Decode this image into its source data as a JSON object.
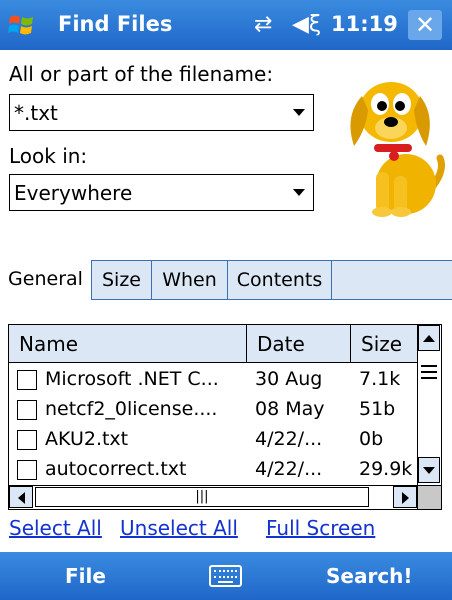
{
  "titlebar": {
    "title": "Find Files",
    "time": "11:19",
    "close_label": "✕",
    "icons": [
      "windows-start-icon",
      "connectivity-icon",
      "volume-icon"
    ]
  },
  "search": {
    "filename_label": "All or part of the filename:",
    "filename_value": "*.txt",
    "lookin_label": "Look in:",
    "lookin_value": "Everywhere"
  },
  "tabs": [
    {
      "label": "General",
      "active": true
    },
    {
      "label": "Size",
      "active": false
    },
    {
      "label": "When",
      "active": false
    },
    {
      "label": "Contents",
      "active": false
    }
  ],
  "results": {
    "columns": [
      "Name",
      "Date",
      "Size"
    ],
    "rows": [
      {
        "name": "Microsoft .NET C...",
        "date": "30 Aug",
        "size": "7.1k"
      },
      {
        "name": "netcf2_0license....",
        "date": "08 May",
        "size": "51b"
      },
      {
        "name": "AKU2.txt",
        "date": "4/22/...",
        "size": "0b"
      },
      {
        "name": "autocorrect.txt",
        "date": "4/22/...",
        "size": "29.9k"
      }
    ]
  },
  "links": {
    "select_all": "Select All",
    "unselect_all": "Unselect All",
    "full_screen": "Full Screen"
  },
  "menubar": {
    "left": "File",
    "right": "Search!",
    "center_icon": "keyboard-icon"
  },
  "colors": {
    "bar_blue": "#1f67c8",
    "tab_bg": "#dbe7f5",
    "link": "#1233d0"
  }
}
